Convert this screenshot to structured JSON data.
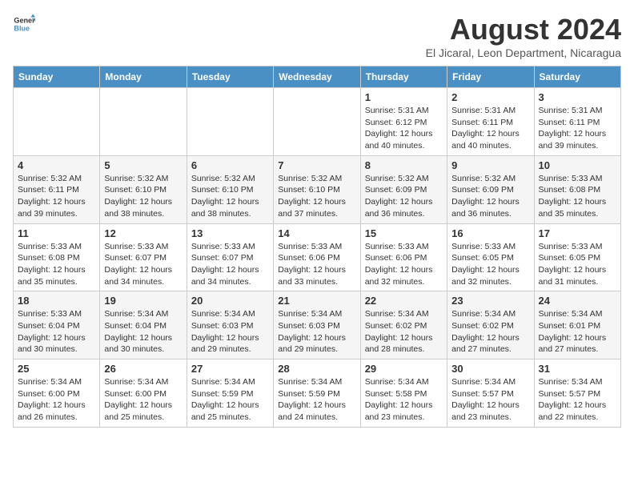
{
  "header": {
    "logo_general": "General",
    "logo_blue": "Blue",
    "main_title": "August 2024",
    "subtitle": "El Jicaral, Leon Department, Nicaragua"
  },
  "calendar": {
    "days_of_week": [
      "Sunday",
      "Monday",
      "Tuesday",
      "Wednesday",
      "Thursday",
      "Friday",
      "Saturday"
    ],
    "weeks": [
      [
        {
          "day": "",
          "info": ""
        },
        {
          "day": "",
          "info": ""
        },
        {
          "day": "",
          "info": ""
        },
        {
          "day": "",
          "info": ""
        },
        {
          "day": "1",
          "info": "Sunrise: 5:31 AM\nSunset: 6:12 PM\nDaylight: 12 hours\nand 40 minutes."
        },
        {
          "day": "2",
          "info": "Sunrise: 5:31 AM\nSunset: 6:11 PM\nDaylight: 12 hours\nand 40 minutes."
        },
        {
          "day": "3",
          "info": "Sunrise: 5:31 AM\nSunset: 6:11 PM\nDaylight: 12 hours\nand 39 minutes."
        }
      ],
      [
        {
          "day": "4",
          "info": "Sunrise: 5:32 AM\nSunset: 6:11 PM\nDaylight: 12 hours\nand 39 minutes."
        },
        {
          "day": "5",
          "info": "Sunrise: 5:32 AM\nSunset: 6:10 PM\nDaylight: 12 hours\nand 38 minutes."
        },
        {
          "day": "6",
          "info": "Sunrise: 5:32 AM\nSunset: 6:10 PM\nDaylight: 12 hours\nand 38 minutes."
        },
        {
          "day": "7",
          "info": "Sunrise: 5:32 AM\nSunset: 6:10 PM\nDaylight: 12 hours\nand 37 minutes."
        },
        {
          "day": "8",
          "info": "Sunrise: 5:32 AM\nSunset: 6:09 PM\nDaylight: 12 hours\nand 36 minutes."
        },
        {
          "day": "9",
          "info": "Sunrise: 5:32 AM\nSunset: 6:09 PM\nDaylight: 12 hours\nand 36 minutes."
        },
        {
          "day": "10",
          "info": "Sunrise: 5:33 AM\nSunset: 6:08 PM\nDaylight: 12 hours\nand 35 minutes."
        }
      ],
      [
        {
          "day": "11",
          "info": "Sunrise: 5:33 AM\nSunset: 6:08 PM\nDaylight: 12 hours\nand 35 minutes."
        },
        {
          "day": "12",
          "info": "Sunrise: 5:33 AM\nSunset: 6:07 PM\nDaylight: 12 hours\nand 34 minutes."
        },
        {
          "day": "13",
          "info": "Sunrise: 5:33 AM\nSunset: 6:07 PM\nDaylight: 12 hours\nand 34 minutes."
        },
        {
          "day": "14",
          "info": "Sunrise: 5:33 AM\nSunset: 6:06 PM\nDaylight: 12 hours\nand 33 minutes."
        },
        {
          "day": "15",
          "info": "Sunrise: 5:33 AM\nSunset: 6:06 PM\nDaylight: 12 hours\nand 32 minutes."
        },
        {
          "day": "16",
          "info": "Sunrise: 5:33 AM\nSunset: 6:05 PM\nDaylight: 12 hours\nand 32 minutes."
        },
        {
          "day": "17",
          "info": "Sunrise: 5:33 AM\nSunset: 6:05 PM\nDaylight: 12 hours\nand 31 minutes."
        }
      ],
      [
        {
          "day": "18",
          "info": "Sunrise: 5:33 AM\nSunset: 6:04 PM\nDaylight: 12 hours\nand 30 minutes."
        },
        {
          "day": "19",
          "info": "Sunrise: 5:34 AM\nSunset: 6:04 PM\nDaylight: 12 hours\nand 30 minutes."
        },
        {
          "day": "20",
          "info": "Sunrise: 5:34 AM\nSunset: 6:03 PM\nDaylight: 12 hours\nand 29 minutes."
        },
        {
          "day": "21",
          "info": "Sunrise: 5:34 AM\nSunset: 6:03 PM\nDaylight: 12 hours\nand 29 minutes."
        },
        {
          "day": "22",
          "info": "Sunrise: 5:34 AM\nSunset: 6:02 PM\nDaylight: 12 hours\nand 28 minutes."
        },
        {
          "day": "23",
          "info": "Sunrise: 5:34 AM\nSunset: 6:02 PM\nDaylight: 12 hours\nand 27 minutes."
        },
        {
          "day": "24",
          "info": "Sunrise: 5:34 AM\nSunset: 6:01 PM\nDaylight: 12 hours\nand 27 minutes."
        }
      ],
      [
        {
          "day": "25",
          "info": "Sunrise: 5:34 AM\nSunset: 6:00 PM\nDaylight: 12 hours\nand 26 minutes."
        },
        {
          "day": "26",
          "info": "Sunrise: 5:34 AM\nSunset: 6:00 PM\nDaylight: 12 hours\nand 25 minutes."
        },
        {
          "day": "27",
          "info": "Sunrise: 5:34 AM\nSunset: 5:59 PM\nDaylight: 12 hours\nand 25 minutes."
        },
        {
          "day": "28",
          "info": "Sunrise: 5:34 AM\nSunset: 5:59 PM\nDaylight: 12 hours\nand 24 minutes."
        },
        {
          "day": "29",
          "info": "Sunrise: 5:34 AM\nSunset: 5:58 PM\nDaylight: 12 hours\nand 23 minutes."
        },
        {
          "day": "30",
          "info": "Sunrise: 5:34 AM\nSunset: 5:57 PM\nDaylight: 12 hours\nand 23 minutes."
        },
        {
          "day": "31",
          "info": "Sunrise: 5:34 AM\nSunset: 5:57 PM\nDaylight: 12 hours\nand 22 minutes."
        }
      ]
    ]
  }
}
